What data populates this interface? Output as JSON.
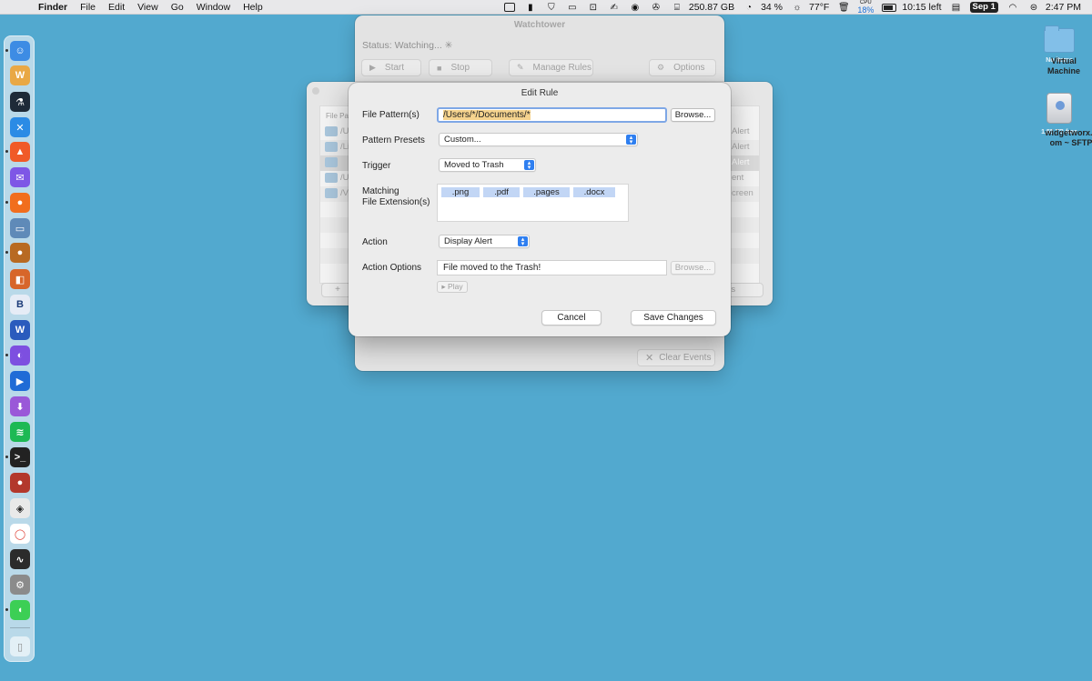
{
  "menubar": {
    "app": "Finder",
    "menus": [
      "File",
      "Edit",
      "View",
      "Go",
      "Window",
      "Help"
    ],
    "disk": "250.87 GB",
    "progress": "34 %",
    "temperature": "77°F",
    "cpu_label": "CPU",
    "cpu_value": "18%",
    "battery": "10:15 left",
    "date": "Sep 1",
    "time": "2:47 PM"
  },
  "desktop": {
    "vm_label": "Virtual Machine",
    "vm_sub": "No items",
    "drive_label": "widgetworx.com ~ SFTP",
    "drive_sub": "1.55 TB free"
  },
  "watchtower": {
    "title": "Watchtower",
    "status": "Status: Watching...",
    "start": "Start",
    "stop": "Stop",
    "manage": "Manage Rules",
    "options": "Options",
    "clear": "Clear Events"
  },
  "rules": {
    "header": "File Pat",
    "rows": [
      {
        "path": "/U",
        "action": "Alert"
      },
      {
        "path": "/Li",
        "action": "Alert"
      },
      {
        "path": "",
        "action": "Alert"
      },
      {
        "path": "/U",
        "action": "ent"
      },
      {
        "path": "/V",
        "action": "creen"
      }
    ],
    "add": "+",
    "manage_partial": "les"
  },
  "dialog": {
    "title": "Edit Rule",
    "file_pattern_label": "File Pattern(s)",
    "file_pattern_value": "/Users/*/Documents/*",
    "browse": "Browse...",
    "presets_label": "Pattern Presets",
    "presets_value": "Custom...",
    "trigger_label": "Trigger",
    "trigger_value": "Moved to Trash",
    "ext_label_1": "Matching",
    "ext_label_2": "File Extension(s)",
    "extensions": [
      ".png",
      ".pdf",
      ".pages",
      ".docx"
    ],
    "action_label": "Action",
    "action_value": "Display Alert",
    "options_label": "Action Options",
    "options_value": "File moved to the Trash!",
    "options_browse": "Browse...",
    "play": "Play",
    "cancel": "Cancel",
    "save": "Save Changes"
  },
  "colors": {
    "desktop": "#52a9cf",
    "accent": "#2f7ff0",
    "token": "#c2d6f5",
    "focus_ring": "#7ea7e6"
  }
}
